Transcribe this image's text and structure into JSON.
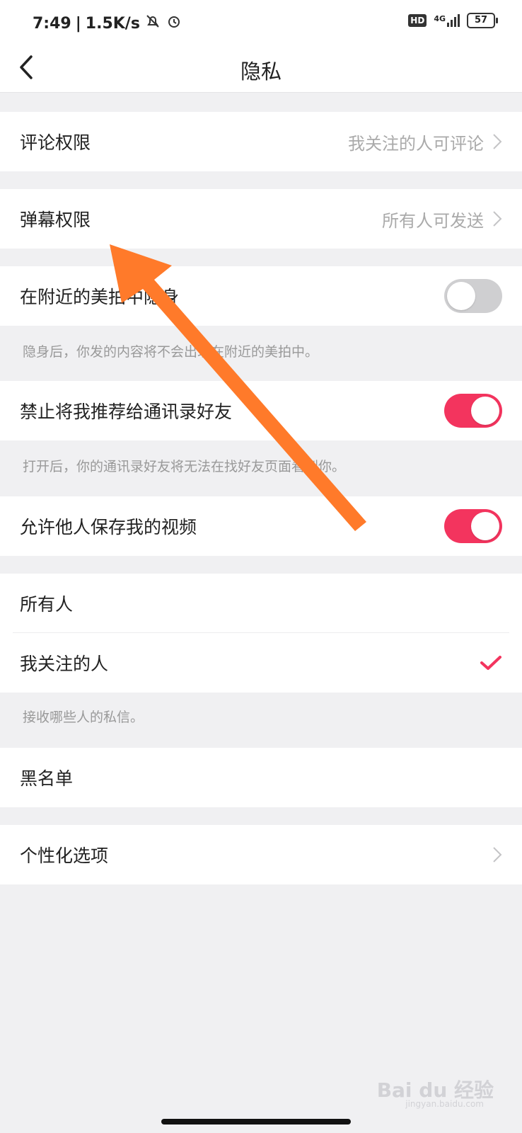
{
  "status_bar": {
    "time": "7:49",
    "speed": "1.5K/s",
    "network": "4G",
    "battery": "57",
    "hd": "HD"
  },
  "header": {
    "title": "隐私"
  },
  "settings": {
    "comment_permission": {
      "label": "评论权限",
      "value": "我关注的人可评论"
    },
    "danmaku_permission": {
      "label": "弹幕权限",
      "value": "所有人可发送"
    },
    "nearby_invisible": {
      "label": "在附近的美拍中隐身",
      "enabled": false,
      "note": "隐身后，你发的内容将不会出现在附近的美拍中。"
    },
    "block_contacts": {
      "label": "禁止将我推荐给通讯录好友",
      "enabled": true,
      "note": "打开后，你的通讯录好友将无法在找好友页面看到你。"
    },
    "allow_save_video": {
      "label": "允许他人保存我的视频",
      "enabled": true
    },
    "dm_everyone": {
      "label": "所有人",
      "selected": false
    },
    "dm_following": {
      "label": "我关注的人",
      "selected": true
    },
    "dm_note": "接收哪些人的私信。",
    "blacklist": {
      "label": "黑名单"
    },
    "personalization": {
      "label": "个性化选项"
    }
  },
  "watermark": {
    "text": "Bai du 经验",
    "sub": "jingyan.baidu.com"
  },
  "colors": {
    "accent": "#f3345e",
    "annotation_arrow": "#ff7a2a"
  }
}
